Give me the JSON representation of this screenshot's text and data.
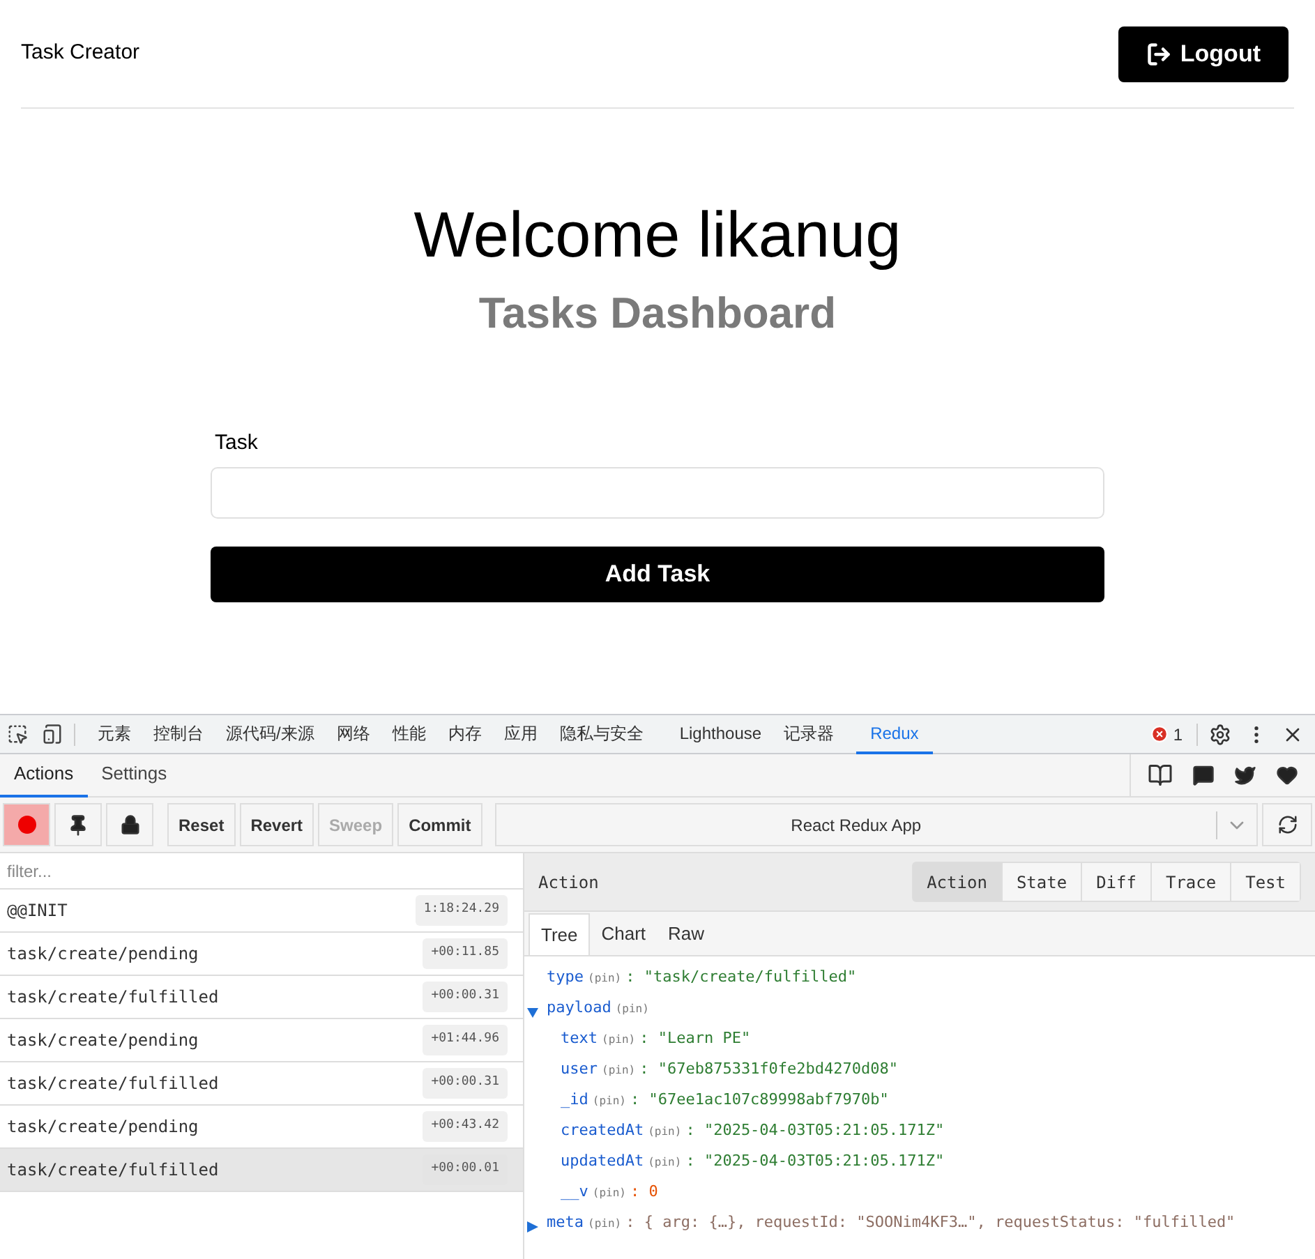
{
  "header": {
    "brand": "Task Creator",
    "logout": "Logout"
  },
  "welcome": {
    "title": "Welcome likanug",
    "subtitle": "Tasks Dashboard"
  },
  "form": {
    "label": "Task",
    "button": "Add Task"
  },
  "devtools": {
    "tabs": [
      {
        "label": "元素",
        "selected": false
      },
      {
        "label": "控制台",
        "selected": false
      },
      {
        "label": "源代码/来源",
        "selected": false
      },
      {
        "label": "网络",
        "selected": false
      },
      {
        "label": "性能",
        "selected": false
      },
      {
        "label": "内存",
        "selected": false
      },
      {
        "label": "应用",
        "selected": false
      },
      {
        "label": "隐私与安全",
        "selected": false
      },
      {
        "label": "Lighthouse",
        "selected": false
      },
      {
        "label": "记录器",
        "selected": false
      },
      {
        "label": "Redux",
        "selected": true
      }
    ],
    "error_count": "1",
    "redux": {
      "subtabs": [
        {
          "label": "Actions",
          "selected": true
        },
        {
          "label": "Settings",
          "selected": false
        }
      ],
      "recording": true,
      "buttons": [
        {
          "label": "Reset",
          "disabled": false
        },
        {
          "label": "Revert",
          "disabled": false
        },
        {
          "label": "Sweep",
          "disabled": true
        },
        {
          "label": "Commit",
          "disabled": false
        }
      ],
      "instance": "React Redux App",
      "filter_placeholder": "filter...",
      "actions": [
        {
          "name": "@@INIT",
          "time": "1:18:24.29",
          "selected": false
        },
        {
          "name": "task/create/pending",
          "time": "+00:11.85",
          "selected": false
        },
        {
          "name": "task/create/fulfilled",
          "time": "+00:00.31",
          "selected": false
        },
        {
          "name": "task/create/pending",
          "time": "+01:44.96",
          "selected": false
        },
        {
          "name": "task/create/fulfilled",
          "time": "+00:00.31",
          "selected": false
        },
        {
          "name": "task/create/pending",
          "time": "+00:43.42",
          "selected": false
        },
        {
          "name": "task/create/fulfilled",
          "time": "+00:00.01",
          "selected": true
        }
      ],
      "inspector_title": "Action",
      "monitor_tabs": [
        {
          "label": "Action",
          "selected": true
        },
        {
          "label": "State",
          "selected": false
        },
        {
          "label": "Diff",
          "selected": false
        },
        {
          "label": "Trace",
          "selected": false
        },
        {
          "label": "Test",
          "selected": false
        }
      ],
      "view_tabs": [
        {
          "label": "Tree",
          "selected": true
        },
        {
          "label": "Chart",
          "selected": false
        },
        {
          "label": "Raw",
          "selected": false
        }
      ],
      "tree": [
        {
          "key": "type",
          "pin": "(pin)",
          "kind": "string",
          "value": ": \"task/create/fulfilled\""
        },
        {
          "key": "payload",
          "pin": "(pin)",
          "kind": "object",
          "expanded": true,
          "children": [
            {
              "key": "text",
              "pin": "(pin)",
              "kind": "string",
              "value": ": \"Learn PE\""
            },
            {
              "key": "user",
              "pin": "(pin)",
              "kind": "string",
              "value": ": \"67eb875331f0fe2bd4270d08\""
            },
            {
              "key": "_id",
              "pin": "(pin)",
              "kind": "string",
              "value": ": \"67ee1ac107c89998abf7970b\""
            },
            {
              "key": "createdAt",
              "pin": "(pin)",
              "kind": "string",
              "value": ": \"2025-04-03T05:21:05.171Z\""
            },
            {
              "key": "updatedAt",
              "pin": "(pin)",
              "kind": "string",
              "value": ": \"2025-04-03T05:21:05.171Z\""
            },
            {
              "key": "__v",
              "pin": "(pin)",
              "kind": "number",
              "value": ": 0"
            }
          ]
        },
        {
          "key": "meta",
          "pin": "(pin)",
          "kind": "object",
          "expanded": false,
          "value": ": { arg: {…}, requestId: \"SOONim4KF3…\", requestStatus: \"fulfilled\""
        }
      ]
    }
  }
}
